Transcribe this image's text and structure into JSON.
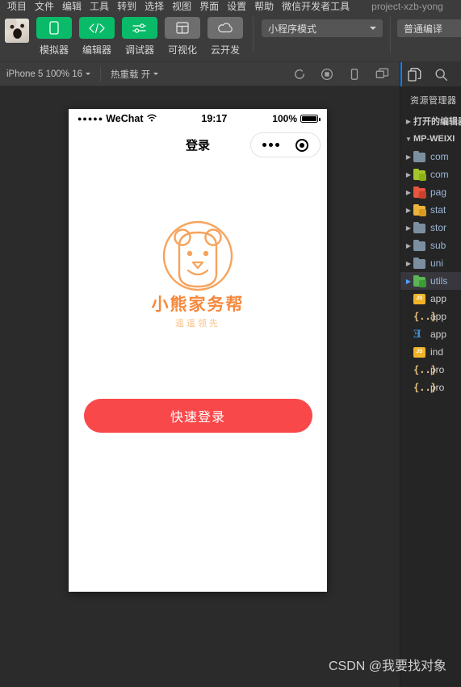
{
  "menubar": {
    "items": [
      "项目",
      "文件",
      "编辑",
      "工具",
      "转到",
      "选择",
      "视图",
      "界面",
      "设置",
      "帮助",
      "微信开发者工具"
    ],
    "project_title": "project-xzb-yong"
  },
  "toolbar": {
    "avatar_name": "user-avatar",
    "buttons": [
      {
        "label": "模拟器",
        "icon": "phone-icon",
        "state": "active"
      },
      {
        "label": "编辑器",
        "icon": "code-icon",
        "state": "active"
      },
      {
        "label": "调试器",
        "icon": "sliders-icon",
        "state": "active"
      },
      {
        "label": "可视化",
        "icon": "layout-icon",
        "state": "inactive"
      },
      {
        "label": "云开发",
        "icon": "cloud-icon",
        "state": "inactive"
      }
    ],
    "mode_select": "小程序模式",
    "compile_select": "普通编译"
  },
  "subbar": {
    "device": "iPhone 5 100% 16",
    "hotreload": "热重载 开",
    "icons": [
      "refresh-icon",
      "record-icon",
      "preview-phone-icon",
      "detach-window-icon"
    ]
  },
  "simulator": {
    "statusbar": {
      "signal_dots": "●●●●●",
      "carrier": "WeChat",
      "wifi_icon": "wifi-icon",
      "time": "19:17",
      "battery_percent": "100%"
    },
    "navbar": {
      "title": "登录",
      "capsule_menu_icon": "more-dots-icon",
      "capsule_target_icon": "target-icon"
    },
    "logo": {
      "icon": "bear-logo-icon",
      "brand": "小熊家务帮",
      "slogan": "遥遥领先",
      "brand_color": "#f5883c",
      "slogan_color": "#fbc182"
    },
    "primary_button": {
      "label": "快速登录",
      "color": "#f9484a"
    }
  },
  "rightpanel": {
    "activity_icons": [
      "files-icon",
      "search-icon"
    ],
    "explorer_title": "资源管理器",
    "sections": [
      {
        "label": "打开的编辑器",
        "expanded": false
      },
      {
        "label": "MP-WEIXI",
        "expanded": true
      }
    ],
    "tree": [
      {
        "name": "com",
        "type": "folder",
        "color": "#7c8fa0",
        "badge": "",
        "selected": false
      },
      {
        "name": "com",
        "type": "folder",
        "color": "#a4c62a",
        "badge": "#8bb018",
        "selected": false
      },
      {
        "name": "pag",
        "type": "folder",
        "color": "#e8563f",
        "badge": "#c9402c",
        "selected": false
      },
      {
        "name": "stat",
        "type": "folder",
        "color": "#eeb33b",
        "badge": "#d99a22",
        "selected": false
      },
      {
        "name": "stor",
        "type": "folder",
        "color": "#7c8fa0",
        "badge": "",
        "selected": false
      },
      {
        "name": "sub",
        "type": "folder",
        "color": "#7c8fa0",
        "badge": "",
        "selected": false
      },
      {
        "name": "uni",
        "type": "folder",
        "color": "#7c8fa0",
        "badge": "",
        "selected": false
      },
      {
        "name": "utils",
        "type": "folder",
        "color": "#5ab552",
        "badge": "#3d9b36",
        "selected": true
      },
      {
        "name": "app",
        "type": "js",
        "color": "#f0b429",
        "selected": false
      },
      {
        "name": "app",
        "type": "json",
        "selected": false
      },
      {
        "name": "app",
        "type": "css",
        "selected": false
      },
      {
        "name": "ind",
        "type": "js",
        "color": "#f0b429",
        "selected": false
      },
      {
        "name": "pro",
        "type": "json",
        "selected": false
      },
      {
        "name": "pro",
        "type": "json",
        "selected": false
      }
    ]
  },
  "watermark": "CSDN @我要找对象"
}
